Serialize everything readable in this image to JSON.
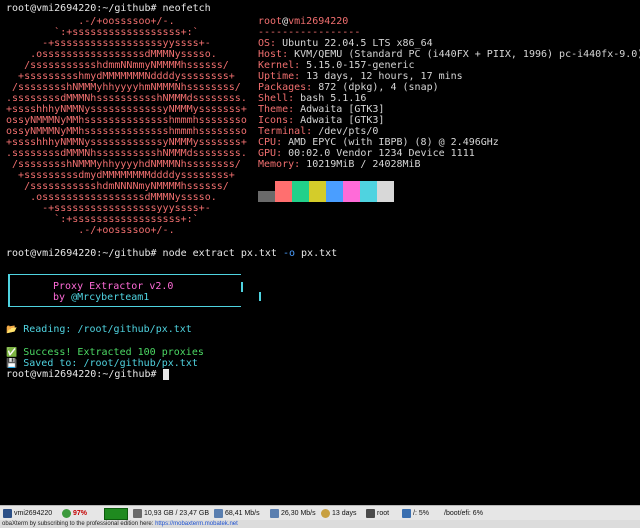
{
  "terminal": {
    "prompt1": "root@vmi2694220:~/github# neofetch",
    "ascii": [
      "             .-/+oossssoo+/-.",
      "         `:+ssssssssssssssssss+:`",
      "       -+ssssssssssssssssssyyssss+-",
      "     .osssssssssssssssssdMMMNysssso.",
      "    /ssssssssssshdmmNNmmyNMMMMhssssss/",
      "   +ssssssssshmydMMMMMMMNddddyssssssss+",
      "  /sssssssshNMMMyhhyyyyhmNMMMNhssssssss/",
      " .ssssssssdMMMNhsssssssssshNMMMdssssssss.",
      " +sssshhhyNMMNyssssssssssssyNMMMysssssss+",
      " ossyNMMMNyMMhsssssssssssssshmmmhssssssso",
      " ossyNMMMNyMMhsssssssssssssshmmmhssssssso",
      " +sssshhhyNMMNyssssssssssssyNMMMysssssss+",
      " .ssssssssdMMMNhsssssssssshNMMMdssssssss.",
      "  /sssssssshNMMMyhhyyyyhdNMMMNhssssssss/",
      "   +sssssssssdmydMMMMMMMMddddyssssssss+",
      "    /ssssssssssshdmNNNNmyNMMMMhssssss/",
      "     .osssssssssssssssssdMMMNysssso.",
      "       -+sssssssssssssssssyyyssss+-",
      "         `:+ssssssssssssssssss+:`",
      "             .-/+oossssoo+/-."
    ],
    "host_user": "root",
    "host_at": "@",
    "host_name": "vmi2694220",
    "separator": "-----------------",
    "info": [
      {
        "key": "OS",
        "value": "Ubuntu 22.04.5 LTS x86_64"
      },
      {
        "key": "Host",
        "value": "KVM/QEMU (Standard PC (i440FX + PIIX, 1996) pc-i440fx-9.0)"
      },
      {
        "key": "Kernel",
        "value": "5.15.0-157-generic"
      },
      {
        "key": "Uptime",
        "value": "13 days, 12 hours, 17 mins"
      },
      {
        "key": "Packages",
        "value": "872 (dpkg), 4 (snap)"
      },
      {
        "key": "Shell",
        "value": "bash 5.1.16"
      },
      {
        "key": "Theme",
        "value": "Adwaita [GTK3]"
      },
      {
        "key": "Icons",
        "value": "Adwaita [GTK3]"
      },
      {
        "key": "Terminal",
        "value": "/dev/pts/0"
      },
      {
        "key": "CPU",
        "value": "AMD EPYC (with IBPB) (8) @ 2.496GHz"
      },
      {
        "key": "GPU",
        "value": "00:02.0 Vendor 1234 Device 1111"
      },
      {
        "key": "Memory",
        "value": "10219MiB / 24028MiB"
      }
    ],
    "palette_top": [
      "#000000",
      "#ff6f6f",
      "#22d08a",
      "#d4cc2a",
      "#4a9eff",
      "#ff6bd8",
      "#4fd3e0",
      "#d8d8d8"
    ],
    "palette_bottom": [
      "#6a6a6a",
      "#ff6f6f",
      "#22d08a",
      "#d4cc2a",
      "#4a9eff",
      "#ff6bd8",
      "#4fd3e0",
      "#d8d8d8"
    ],
    "prompt2": "root@vmi2694220:~/github# ",
    "cmd_node": "node extract px.txt ",
    "cmd_flag": "-o",
    "cmd_out": " px.txt",
    "banner_title": "Proxy Extractor v2.0",
    "banner_by": "by ",
    "banner_author": "@Mrcyberteam1",
    "reading_icon": "📂",
    "reading_label": "Reading: ",
    "reading_path": "/root/github/px.txt",
    "success_icon": "✅",
    "success_text": "Success! Extracted 100 proxies",
    "saved_icon": "💾",
    "saved_label": "Saved to: ",
    "saved_path": "/root/github/px.txt",
    "prompt3": "root@vmi2694220:~/github# "
  },
  "statusbar": {
    "host": "vmi2694220",
    "cpu": "97%",
    "disk": "10,93 GB / 23,47 GB",
    "net_up": "68,41 Mb/s",
    "net_down": "26,30 Mb/s",
    "uptime": "13 days",
    "user": "root",
    "mount1": "/: 5%",
    "mount2": "/boot/efi: 6%"
  },
  "footer": {
    "text": "obaXterm by subscribing to the professional edition here: ",
    "link": "https://mobaxterm.mobatek.net"
  }
}
